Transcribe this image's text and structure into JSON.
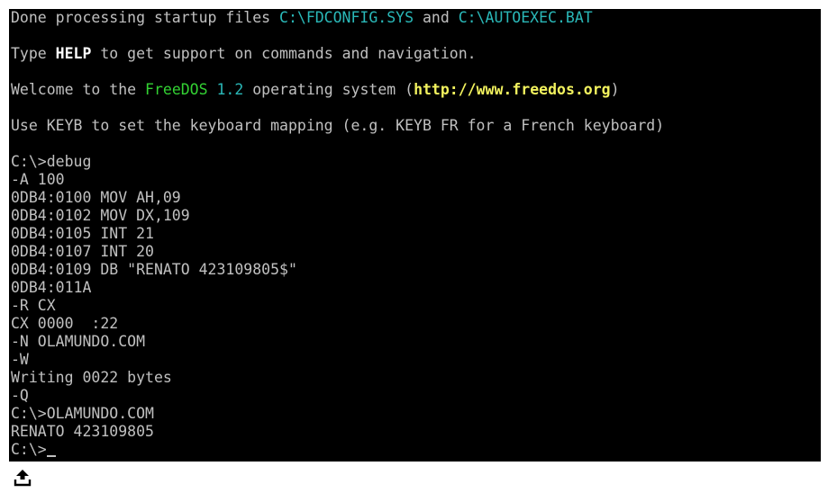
{
  "screen": {
    "startup": {
      "prefix": "Done processing startup files ",
      "fdconfig": "C:\\FDCONFIG.SYS",
      "and": " and ",
      "autoexec": "C:\\AUTOEXEC.BAT"
    },
    "help": {
      "prefix": "Type ",
      "word": "HELP",
      "suffix": " to get support on commands and navigation."
    },
    "welcome": {
      "prefix": "Welcome to the ",
      "freedos": "FreeDOS",
      "version": " 1.2",
      "middle": " operating system (",
      "url": "http://www.freedos.org",
      "suffix": ")"
    },
    "keyb": "Use KEYB to set the keyboard mapping (e.g. KEYB FR for a French keyboard)",
    "session": [
      "C:\\>debug",
      "-A 100",
      "0DB4:0100 MOV AH,09",
      "0DB4:0102 MOV DX,109",
      "0DB4:0105 INT 21",
      "0DB4:0107 INT 20",
      "0DB4:0109 DB \"RENATO 423109805$\"",
      "0DB4:011A",
      "-R CX",
      "CX 0000  :22",
      "-N OLAMUNDO.COM",
      "-W",
      "Writing 0022 bytes",
      "-Q",
      "C:\\>OLAMUNDO.COM",
      "RENATO 423109805"
    ],
    "prompt": "C:\\>"
  },
  "colors": {
    "background": "#000000",
    "text": "#c0c0c0",
    "cyan": "#2ab8b8",
    "green": "#33d233",
    "yellow": "#f2f25e"
  },
  "icons": {
    "upload": "upload-icon"
  }
}
